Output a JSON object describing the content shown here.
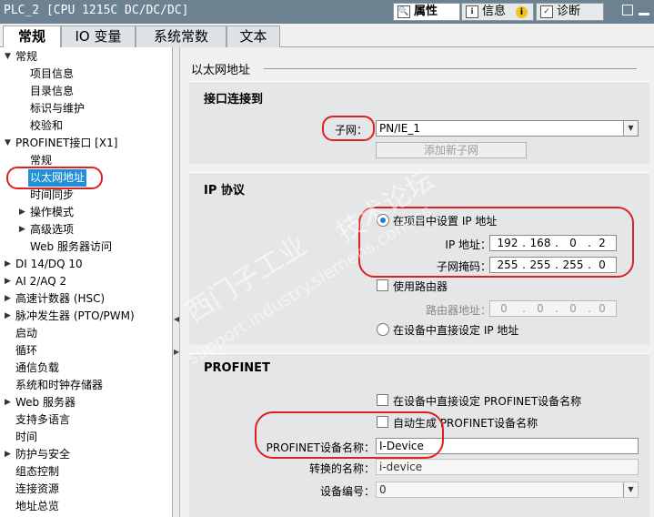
{
  "titlebar": {
    "title": "PLC_2 [CPU 1215C DC/DC/DC]",
    "tabs": [
      {
        "label": "属性",
        "icon": "properties-icon"
      },
      {
        "label": "信息",
        "icon": "info-icon"
      },
      {
        "label": "诊断",
        "icon": "diagnostics-icon"
      }
    ],
    "info_badge": "i"
  },
  "tabs": [
    "常规",
    "IO 变量",
    "系统常数",
    "文本"
  ],
  "tree": [
    {
      "label": "常规",
      "level": 0
    },
    {
      "label": "项目信息",
      "level": 1
    },
    {
      "label": "目录信息",
      "level": 1
    },
    {
      "label": "标识与维护",
      "level": 1
    },
    {
      "label": "校验和",
      "level": 1
    },
    {
      "label": "PROFINET接口 [X1]",
      "level": 0
    },
    {
      "label": "常规",
      "level": 1
    },
    {
      "label": "以太网地址",
      "level": 1
    },
    {
      "label": "时间同步",
      "level": 1
    },
    {
      "label": "操作模式",
      "level": 1
    },
    {
      "label": "高级选项",
      "level": 1
    },
    {
      "label": "Web 服务器访问",
      "level": 1
    },
    {
      "label": "DI 14/DQ 10",
      "level": 0
    },
    {
      "label": "AI 2/AQ 2",
      "level": 0
    },
    {
      "label": "高速计数器 (HSC)",
      "level": 0
    },
    {
      "label": "脉冲发生器 (PTO/PWM)",
      "level": 0
    },
    {
      "label": "启动",
      "level": 0
    },
    {
      "label": "循环",
      "level": 0
    },
    {
      "label": "通信负载",
      "level": 0
    },
    {
      "label": "系统和时钟存储器",
      "level": 0
    },
    {
      "label": "Web 服务器",
      "level": 0
    },
    {
      "label": "支持多语言",
      "level": 0
    },
    {
      "label": "时间",
      "level": 0
    },
    {
      "label": "防护与安全",
      "level": 0
    },
    {
      "label": "组态控制",
      "level": 0
    },
    {
      "label": "连接资源",
      "level": 0
    },
    {
      "label": "地址总览",
      "level": 0
    }
  ],
  "main": {
    "header": "以太网地址",
    "interface": {
      "title": "接口连接到",
      "subnet_label": "子网：",
      "subnet_value": "PN/IE_1",
      "add_subnet_button": "添加新子网"
    },
    "ip": {
      "title": "IP 协议",
      "set_in_project": "在项目中设置 IP 地址",
      "ip_label": "IP 地址：",
      "ip_value": [
        "192",
        "168",
        "0",
        "2"
      ],
      "mask_label": "子网掩码：",
      "mask_value": [
        "255",
        "255",
        "255",
        "0"
      ],
      "use_router": "使用路由器",
      "router_label": "路由器地址：",
      "router_value": [
        "0",
        "0",
        "0",
        "0"
      ],
      "set_on_device": "在设备中直接设定 IP 地址"
    },
    "profinet": {
      "title": "PROFINET",
      "set_name_on_device": "在设备中直接设定 PROFINET设备名称",
      "auto_generate": "自动生成 PROFINET设备名称",
      "device_name_label": "PROFINET设备名称：",
      "device_name_value": "I-Device",
      "converted_label": "转换的名称：",
      "converted_value": "i-device",
      "device_number_label": "设备编号：",
      "device_number_value": "0"
    },
    "watermark": [
      "西门子工业",
      "技术论坛",
      "support.industry.siemens.com/cs"
    ]
  },
  "colors": {
    "titlebar": "#6d8290",
    "selection": "#1e8fd8",
    "annotation": "#e02020"
  }
}
